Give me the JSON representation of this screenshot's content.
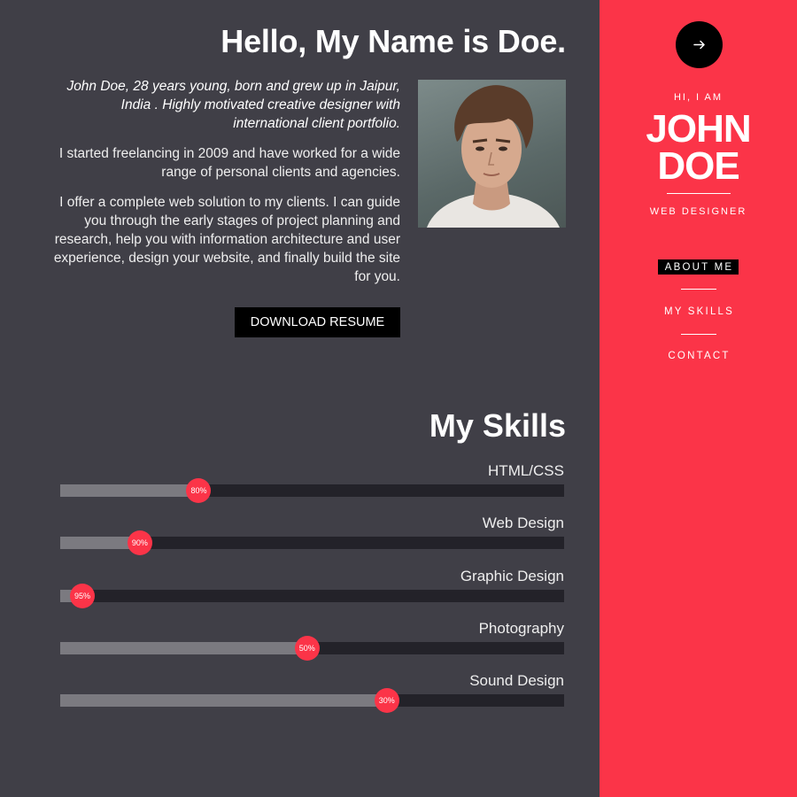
{
  "main": {
    "title": "Hello, My Name is Doe.",
    "intro": "John Doe, 28 years young, born and grew up in Jaipur, India . Highly motivated creative designer with international client portfolio.",
    "paragraphs": [
      "I started freelancing in 2009 and have worked for a wide range of personal clients and agencies.",
      "I offer a complete web solution to my clients. I can guide you through the early stages of project planning and research, help you with information architecture and user experience, design your website, and finally build the site for you."
    ],
    "download_label": "DOWNLOAD RESUME"
  },
  "skills": {
    "title": "My Skills",
    "items": [
      {
        "name": "HTML/CSS",
        "label": "80%",
        "fill": 0.275
      },
      {
        "name": "Web Design",
        "label": "90%",
        "fill": 0.158
      },
      {
        "name": "Graphic Design",
        "label": "95%",
        "fill": 0.044
      },
      {
        "name": "Photography",
        "label": "50%",
        "fill": 0.49
      },
      {
        "name": "Sound Design",
        "label": "30%",
        "fill": 0.648
      }
    ]
  },
  "sidebar": {
    "greeting": "HI, I AM",
    "first_name": "JOHN",
    "last_name": "DOE",
    "role": "WEB DESIGNER",
    "nav": {
      "about": "ABOUT ME",
      "skills": "MY SKILLS",
      "contact": "CONTACT"
    },
    "toggle_icon": "arrow-right-icon"
  },
  "colors": {
    "background": "#403f47",
    "accent": "#fb3448",
    "track": "#232229",
    "fill": "#7b7a80"
  }
}
